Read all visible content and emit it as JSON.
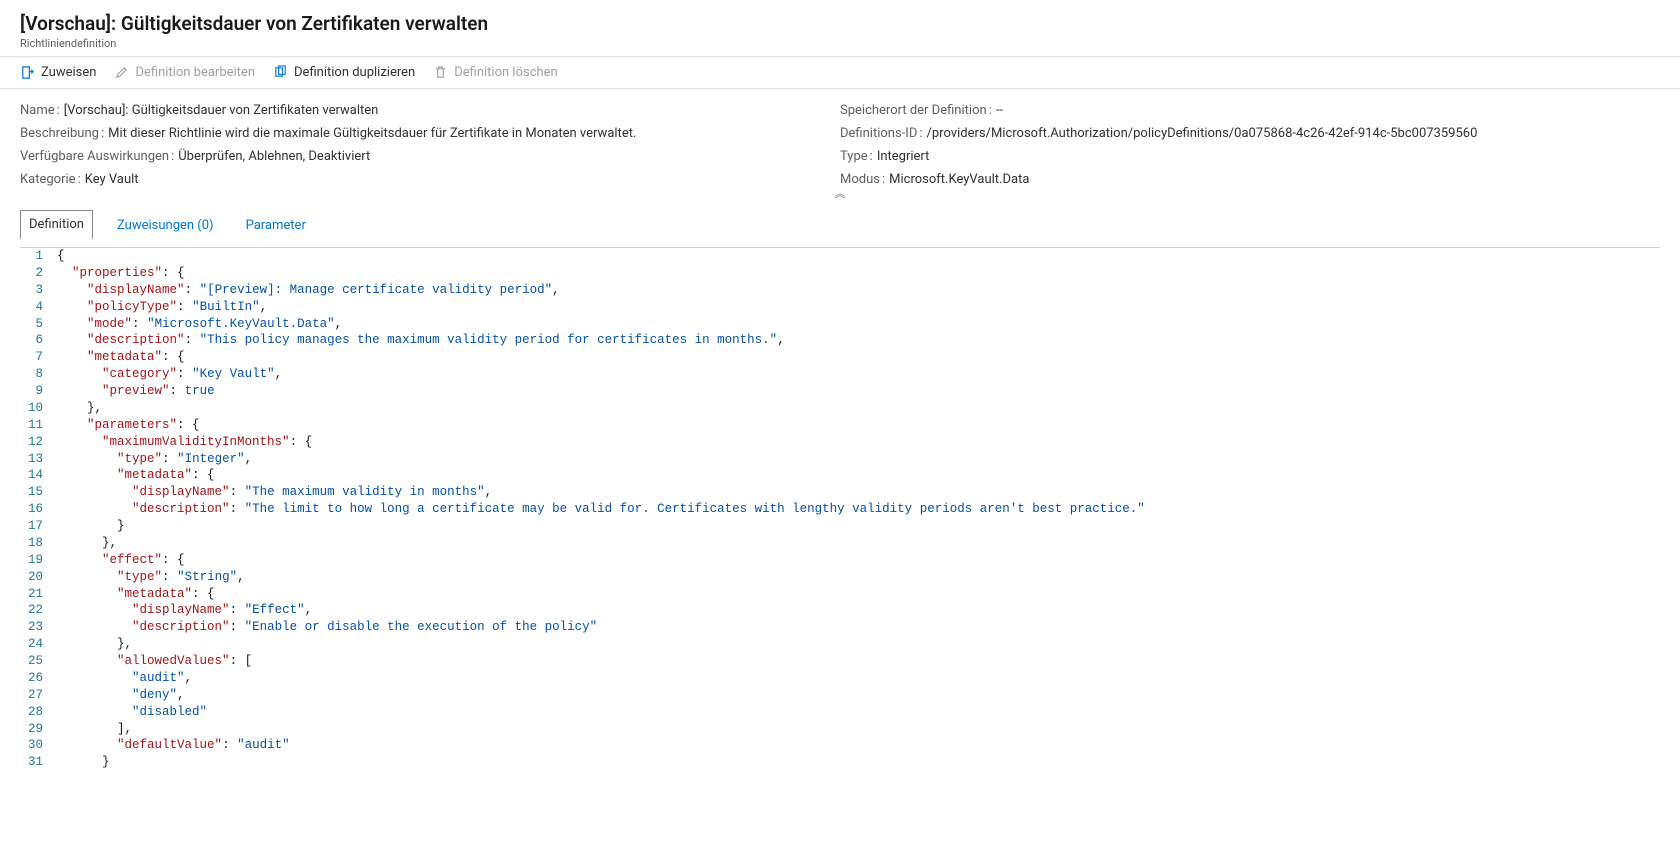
{
  "header": {
    "title": "[Vorschau]: Gültigkeitsdauer von Zertifikaten verwalten",
    "subtitle": "Richtliniendefinition"
  },
  "toolbar": {
    "assign": "Zuweisen",
    "edit": "Definition bearbeiten",
    "duplicate": "Definition duplizieren",
    "delete": "Definition löschen"
  },
  "details": {
    "left": [
      {
        "label": "Name",
        "value": "[Vorschau]: Gültigkeitsdauer von Zertifikaten verwalten"
      },
      {
        "label": "Beschreibung",
        "value": "Mit dieser Richtlinie wird die maximale Gültigkeitsdauer für Zertifikate in Monaten verwaltet."
      },
      {
        "label": "Verfügbare Auswirkungen",
        "value": "Überprüfen, Ablehnen, Deaktiviert"
      },
      {
        "label": "Kategorie",
        "value": "Key Vault"
      }
    ],
    "right": [
      {
        "label": "Speicherort der Definition",
        "value": "--"
      },
      {
        "label": "Definitions-ID",
        "value": "/providers/Microsoft.Authorization/policyDefinitions/0a075868-4c26-42ef-914c-5bc007359560"
      },
      {
        "label": "Type",
        "value": "Integriert"
      },
      {
        "label": "Modus",
        "value": "Microsoft.KeyVault.Data"
      }
    ]
  },
  "tabs": {
    "definition": "Definition",
    "assignments": "Zuweisungen (0)",
    "parameters": "Parameter"
  },
  "code_lines": [
    [
      {
        "t": "pun",
        "v": "{"
      }
    ],
    [
      {
        "t": "ind",
        "v": "  "
      },
      {
        "t": "key",
        "v": "\"properties\""
      },
      {
        "t": "pun",
        "v": ": {"
      }
    ],
    [
      {
        "t": "ind",
        "v": "    "
      },
      {
        "t": "key",
        "v": "\"displayName\""
      },
      {
        "t": "pun",
        "v": ": "
      },
      {
        "t": "str",
        "v": "\"[Preview]: Manage certificate validity period\""
      },
      {
        "t": "pun",
        "v": ","
      }
    ],
    [
      {
        "t": "ind",
        "v": "    "
      },
      {
        "t": "key",
        "v": "\"policyType\""
      },
      {
        "t": "pun",
        "v": ": "
      },
      {
        "t": "str",
        "v": "\"BuiltIn\""
      },
      {
        "t": "pun",
        "v": ","
      }
    ],
    [
      {
        "t": "ind",
        "v": "    "
      },
      {
        "t": "key",
        "v": "\"mode\""
      },
      {
        "t": "pun",
        "v": ": "
      },
      {
        "t": "str",
        "v": "\"Microsoft.KeyVault.Data\""
      },
      {
        "t": "pun",
        "v": ","
      }
    ],
    [
      {
        "t": "ind",
        "v": "    "
      },
      {
        "t": "key",
        "v": "\"description\""
      },
      {
        "t": "pun",
        "v": ": "
      },
      {
        "t": "str",
        "v": "\"This policy manages the maximum validity period for certificates in months.\""
      },
      {
        "t": "pun",
        "v": ","
      }
    ],
    [
      {
        "t": "ind",
        "v": "    "
      },
      {
        "t": "key",
        "v": "\"metadata\""
      },
      {
        "t": "pun",
        "v": ": {"
      }
    ],
    [
      {
        "t": "ind",
        "v": "      "
      },
      {
        "t": "key",
        "v": "\"category\""
      },
      {
        "t": "pun",
        "v": ": "
      },
      {
        "t": "str",
        "v": "\"Key Vault\""
      },
      {
        "t": "pun",
        "v": ","
      }
    ],
    [
      {
        "t": "ind",
        "v": "      "
      },
      {
        "t": "key",
        "v": "\"preview\""
      },
      {
        "t": "pun",
        "v": ": "
      },
      {
        "t": "bool",
        "v": "true"
      }
    ],
    [
      {
        "t": "ind",
        "v": "    "
      },
      {
        "t": "pun",
        "v": "},"
      }
    ],
    [
      {
        "t": "ind",
        "v": "    "
      },
      {
        "t": "key",
        "v": "\"parameters\""
      },
      {
        "t": "pun",
        "v": ": {"
      }
    ],
    [
      {
        "t": "ind",
        "v": "      "
      },
      {
        "t": "key",
        "v": "\"maximumValidityInMonths\""
      },
      {
        "t": "pun",
        "v": ": {"
      }
    ],
    [
      {
        "t": "ind",
        "v": "        "
      },
      {
        "t": "key",
        "v": "\"type\""
      },
      {
        "t": "pun",
        "v": ": "
      },
      {
        "t": "str",
        "v": "\"Integer\""
      },
      {
        "t": "pun",
        "v": ","
      }
    ],
    [
      {
        "t": "ind",
        "v": "        "
      },
      {
        "t": "key",
        "v": "\"metadata\""
      },
      {
        "t": "pun",
        "v": ": {"
      }
    ],
    [
      {
        "t": "ind",
        "v": "          "
      },
      {
        "t": "key",
        "v": "\"displayName\""
      },
      {
        "t": "pun",
        "v": ": "
      },
      {
        "t": "str",
        "v": "\"The maximum validity in months\""
      },
      {
        "t": "pun",
        "v": ","
      }
    ],
    [
      {
        "t": "ind",
        "v": "          "
      },
      {
        "t": "key",
        "v": "\"description\""
      },
      {
        "t": "pun",
        "v": ": "
      },
      {
        "t": "str",
        "v": "\"The limit to how long a certificate may be valid for. Certificates with lengthy validity periods aren't best practice.\""
      }
    ],
    [
      {
        "t": "ind",
        "v": "        "
      },
      {
        "t": "pun",
        "v": "}"
      }
    ],
    [
      {
        "t": "ind",
        "v": "      "
      },
      {
        "t": "pun",
        "v": "},"
      }
    ],
    [
      {
        "t": "ind",
        "v": "      "
      },
      {
        "t": "key",
        "v": "\"effect\""
      },
      {
        "t": "pun",
        "v": ": {"
      }
    ],
    [
      {
        "t": "ind",
        "v": "        "
      },
      {
        "t": "key",
        "v": "\"type\""
      },
      {
        "t": "pun",
        "v": ": "
      },
      {
        "t": "str",
        "v": "\"String\""
      },
      {
        "t": "pun",
        "v": ","
      }
    ],
    [
      {
        "t": "ind",
        "v": "        "
      },
      {
        "t": "key",
        "v": "\"metadata\""
      },
      {
        "t": "pun",
        "v": ": {"
      }
    ],
    [
      {
        "t": "ind",
        "v": "          "
      },
      {
        "t": "key",
        "v": "\"displayName\""
      },
      {
        "t": "pun",
        "v": ": "
      },
      {
        "t": "str",
        "v": "\"Effect\""
      },
      {
        "t": "pun",
        "v": ","
      }
    ],
    [
      {
        "t": "ind",
        "v": "          "
      },
      {
        "t": "key",
        "v": "\"description\""
      },
      {
        "t": "pun",
        "v": ": "
      },
      {
        "t": "str",
        "v": "\"Enable or disable the execution of the policy\""
      }
    ],
    [
      {
        "t": "ind",
        "v": "        "
      },
      {
        "t": "pun",
        "v": "},"
      }
    ],
    [
      {
        "t": "ind",
        "v": "        "
      },
      {
        "t": "key",
        "v": "\"allowedValues\""
      },
      {
        "t": "pun",
        "v": ": ["
      }
    ],
    [
      {
        "t": "ind",
        "v": "          "
      },
      {
        "t": "str",
        "v": "\"audit\""
      },
      {
        "t": "pun",
        "v": ","
      }
    ],
    [
      {
        "t": "ind",
        "v": "          "
      },
      {
        "t": "str",
        "v": "\"deny\""
      },
      {
        "t": "pun",
        "v": ","
      }
    ],
    [
      {
        "t": "ind",
        "v": "          "
      },
      {
        "t": "str",
        "v": "\"disabled\""
      }
    ],
    [
      {
        "t": "ind",
        "v": "        "
      },
      {
        "t": "pun",
        "v": "],"
      }
    ],
    [
      {
        "t": "ind",
        "v": "        "
      },
      {
        "t": "key",
        "v": "\"defaultValue\""
      },
      {
        "t": "pun",
        "v": ": "
      },
      {
        "t": "str",
        "v": "\"audit\""
      }
    ],
    [
      {
        "t": "ind",
        "v": "      "
      },
      {
        "t": "pun",
        "v": "}"
      }
    ]
  ]
}
